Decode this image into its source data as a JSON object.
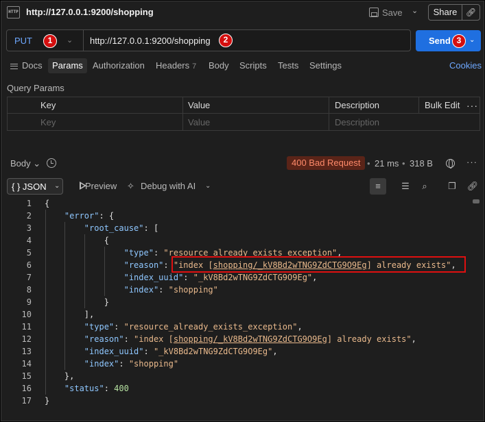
{
  "window": {
    "title": "http://127.0.0.1:9200/shopping",
    "icon": "http-file-icon"
  },
  "header": {
    "save_label": "Save",
    "share_label": "Share"
  },
  "request": {
    "method": "PUT",
    "url": "http://127.0.0.1:9200/shopping",
    "send_label": "Send",
    "badges": [
      "1",
      "2",
      "3"
    ]
  },
  "tabs": [
    {
      "label": "Docs"
    },
    {
      "label": "Params"
    },
    {
      "label": "Authorization"
    },
    {
      "label": "Headers",
      "count": "7"
    },
    {
      "label": "Body"
    },
    {
      "label": "Scripts"
    },
    {
      "label": "Tests"
    },
    {
      "label": "Settings"
    }
  ],
  "cookies_label": "Cookies",
  "query_params": {
    "label": "Query Params",
    "columns": {
      "key": "Key",
      "value": "Value",
      "description": "Description",
      "bulk_edit": "Bulk Edit"
    },
    "placeholder_row": {
      "key": "Key",
      "value": "Value",
      "description": "Description"
    }
  },
  "response": {
    "body_label": "Body",
    "status": "400 Bad Request",
    "time": "21 ms",
    "size": "318 B",
    "status_color": "#ff8a6a",
    "view": {
      "format": "JSON",
      "format_icon": "{ }",
      "preview": "Preview",
      "debug": "Debug with AI"
    }
  },
  "code_lines": [
    {
      "n": "1",
      "t": [
        [
          "p",
          "{"
        ]
      ]
    },
    {
      "n": "2",
      "t": [
        [
          "p",
          "    "
        ],
        [
          "k",
          "\"error\""
        ],
        [
          "p",
          ": {"
        ]
      ]
    },
    {
      "n": "3",
      "t": [
        [
          "p",
          "        "
        ],
        [
          "k",
          "\"root_cause\""
        ],
        [
          "p",
          ": ["
        ]
      ]
    },
    {
      "n": "4",
      "t": [
        [
          "p",
          "            {"
        ]
      ]
    },
    {
      "n": "5",
      "t": [
        [
          "p",
          "                "
        ],
        [
          "k",
          "\"type\""
        ],
        [
          "p",
          ": "
        ],
        [
          "s",
          "\"resource_already_exists_exception\""
        ],
        [
          "p",
          ","
        ]
      ]
    },
    {
      "n": "6",
      "t": [
        [
          "p",
          "                "
        ],
        [
          "k",
          "\"reason\""
        ],
        [
          "p",
          ": "
        ],
        [
          "s",
          "\"index ["
        ],
        [
          "su",
          "shopping/_kV8Bd2wTNG9ZdCTG9O9Eg"
        ],
        [
          "s",
          "] already exists\""
        ],
        [
          "p",
          ","
        ]
      ]
    },
    {
      "n": "7",
      "t": [
        [
          "p",
          "                "
        ],
        [
          "k",
          "\"index_uuid\""
        ],
        [
          "p",
          ": "
        ],
        [
          "s",
          "\"_kV8Bd2wTNG9ZdCTG9O9Eg\""
        ],
        [
          "p",
          ","
        ]
      ]
    },
    {
      "n": "8",
      "t": [
        [
          "p",
          "                "
        ],
        [
          "k",
          "\"index\""
        ],
        [
          "p",
          ": "
        ],
        [
          "s",
          "\"shopping\""
        ]
      ]
    },
    {
      "n": "9",
      "t": [
        [
          "p",
          "            }"
        ]
      ]
    },
    {
      "n": "10",
      "t": [
        [
          "p",
          "        ],"
        ]
      ]
    },
    {
      "n": "11",
      "t": [
        [
          "p",
          "        "
        ],
        [
          "k",
          "\"type\""
        ],
        [
          "p",
          ": "
        ],
        [
          "s",
          "\"resource_already_exists_exception\""
        ],
        [
          "p",
          ","
        ]
      ]
    },
    {
      "n": "12",
      "t": [
        [
          "p",
          "        "
        ],
        [
          "k",
          "\"reason\""
        ],
        [
          "p",
          ": "
        ],
        [
          "s",
          "\"index ["
        ],
        [
          "su",
          "shopping/_kV8Bd2wTNG9ZdCTG9O9Eg"
        ],
        [
          "s",
          "] already exists\""
        ],
        [
          "p",
          ","
        ]
      ]
    },
    {
      "n": "13",
      "t": [
        [
          "p",
          "        "
        ],
        [
          "k",
          "\"index_uuid\""
        ],
        [
          "p",
          ": "
        ],
        [
          "s",
          "\"_kV8Bd2wTNG9ZdCTG9O9Eg\""
        ],
        [
          "p",
          ","
        ]
      ]
    },
    {
      "n": "14",
      "t": [
        [
          "p",
          "        "
        ],
        [
          "k",
          "\"index\""
        ],
        [
          "p",
          ": "
        ],
        [
          "s",
          "\"shopping\""
        ]
      ]
    },
    {
      "n": "15",
      "t": [
        [
          "p",
          "    },"
        ]
      ]
    },
    {
      "n": "16",
      "t": [
        [
          "p",
          "    "
        ],
        [
          "k",
          "\"status\""
        ],
        [
          "p",
          ": "
        ],
        [
          "n",
          "400"
        ]
      ]
    },
    {
      "n": "17",
      "t": [
        [
          "p",
          "}"
        ]
      ]
    }
  ]
}
